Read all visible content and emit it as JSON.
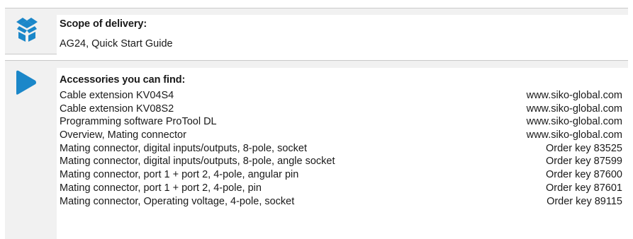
{
  "colors": {
    "accent": "#1b87c9",
    "box_background": "#f1f1f1",
    "border": "#c9c9c9"
  },
  "scope": {
    "icon": "box-icon",
    "heading": "Scope of delivery:",
    "text": "AG24, Quick Start Guide"
  },
  "accessories": {
    "icon": "arrow-right-icon",
    "heading": "Accessories you can find:",
    "items": [
      {
        "description": "Cable extension KV04S4",
        "reference": "www.siko-global.com"
      },
      {
        "description": "Cable extension KV08S2",
        "reference": "www.siko-global.com"
      },
      {
        "description": "Programming software ProTool DL",
        "reference": "www.siko-global.com"
      },
      {
        "description": "Overview, Mating connector",
        "reference": "www.siko-global.com"
      },
      {
        "description": "Mating connector, digital inputs/outputs, 8-pole, socket",
        "reference": "Order key 83525"
      },
      {
        "description": "Mating connector, digital inputs/outputs, 8-pole, angle socket",
        "reference": "Order key 87599"
      },
      {
        "description": "Mating connector, port 1 + port 2, 4-pole, angular pin",
        "reference": "Order key 87600"
      },
      {
        "description": "Mating connector, port 1 + port 2, 4-pole, pin",
        "reference": "Order key 87601"
      },
      {
        "description": "Mating connector, Operating voltage, 4-pole, socket",
        "reference": "Order key 89115"
      }
    ]
  }
}
